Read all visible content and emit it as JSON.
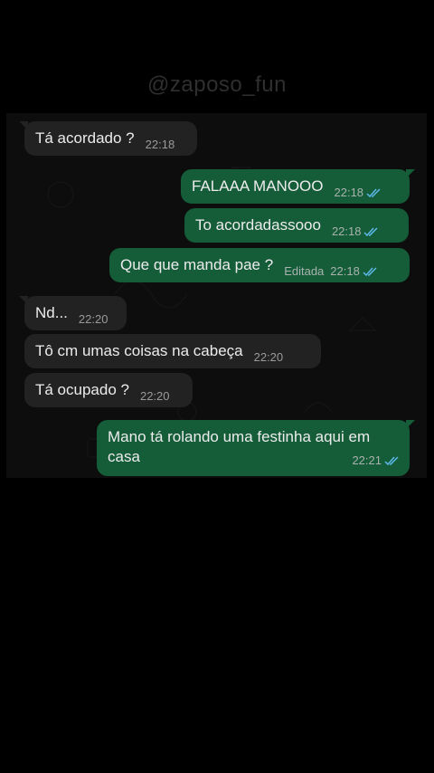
{
  "watermark": "@zaposo_fun",
  "colors": {
    "incoming_bubble": "#222222",
    "outgoing_bubble": "#155c39",
    "read_ticks": "#5bb8e8",
    "background": "#000000"
  },
  "messages": [
    {
      "direction": "in",
      "text": "Tá acordado ?",
      "time": "22:18"
    },
    {
      "direction": "out",
      "text": "FALAAA MANOOO",
      "time": "22:18",
      "status": "read"
    },
    {
      "direction": "out",
      "text": "To acordadassooo",
      "time": "22:18",
      "status": "read"
    },
    {
      "direction": "out",
      "text": "Que que manda pae ?",
      "time": "22:18",
      "edited_label": "Editada",
      "status": "read"
    },
    {
      "direction": "in",
      "text": "Nd...",
      "time": "22:20"
    },
    {
      "direction": "in",
      "text": "Tô cm umas coisas na cabeça",
      "time": "22:20"
    },
    {
      "direction": "in",
      "text": "Tá ocupado ?",
      "time": "22:20"
    },
    {
      "direction": "out",
      "text": "Mano tá rolando uma festinha aqui em casa",
      "time": "22:21",
      "status": "read"
    }
  ]
}
